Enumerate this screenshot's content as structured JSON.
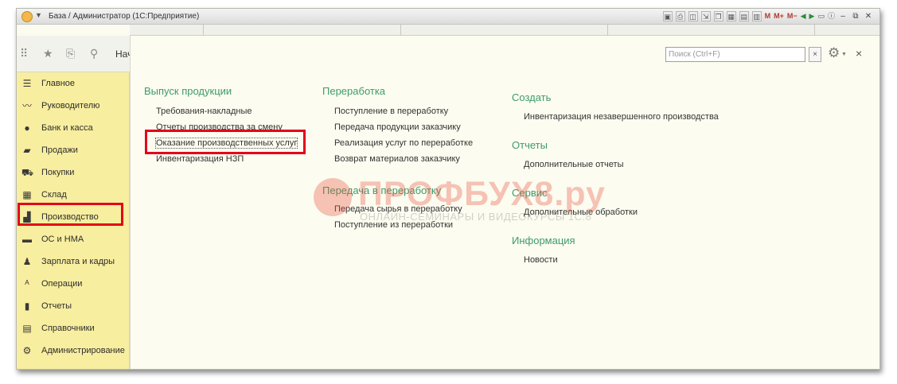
{
  "window": {
    "title": "База / Администратор  (1С:Предприятие)",
    "title_tools": [
      "M",
      "M+",
      "M−"
    ]
  },
  "toolbar": {
    "nav_text": "Нач"
  },
  "sidebar": {
    "items": [
      {
        "label": "Главное",
        "icon": "menu-icon"
      },
      {
        "label": "Руководителю",
        "icon": "chart-line-icon"
      },
      {
        "label": "Банк и касса",
        "icon": "coin-icon"
      },
      {
        "label": "Продажи",
        "icon": "bag-icon"
      },
      {
        "label": "Покупки",
        "icon": "cart-icon"
      },
      {
        "label": "Склад",
        "icon": "warehouse-icon"
      },
      {
        "label": "Производство",
        "icon": "factory-icon"
      },
      {
        "label": "ОС и НМА",
        "icon": "truck-icon"
      },
      {
        "label": "Зарплата и кадры",
        "icon": "person-icon"
      },
      {
        "label": "Операции",
        "icon": "operations-icon"
      },
      {
        "label": "Отчеты",
        "icon": "bar-chart-icon"
      },
      {
        "label": "Справочники",
        "icon": "book-icon"
      },
      {
        "label": "Администрирование",
        "icon": "gear-icon"
      }
    ],
    "selected": "Производство"
  },
  "panel": {
    "search_placeholder": "Поиск (Ctrl+F)",
    "search_clear": "×",
    "close": "×",
    "columns": [
      {
        "sections": [
          {
            "title": "Выпуск продукции",
            "links": [
              "Требования-накладные",
              "Отчеты производства за смену",
              "Оказание производственных услуг",
              "Инвентаризация НЗП"
            ]
          }
        ]
      },
      {
        "sections": [
          {
            "title": "Переработка",
            "links": [
              "Поступление в переработку",
              "Передача продукции заказчику",
              "Реализация услуг по переработке",
              "Возврат материалов заказчику"
            ]
          },
          {
            "title": "Передача в переработку",
            "links": [
              "Передача сырья в переработку",
              "Поступление из переработки"
            ]
          }
        ]
      },
      {
        "sections": [
          {
            "title": "Создать",
            "links": [
              "Инвентаризация незавершенного производства"
            ]
          },
          {
            "title": "Отчеты",
            "links": [
              "Дополнительные отчеты"
            ]
          },
          {
            "title": "Сервис",
            "links": [
              "Дополнительные обработки"
            ]
          },
          {
            "title": "Информация",
            "links": [
              "Новости"
            ]
          }
        ]
      }
    ],
    "focused_link": "Оказание производственных услуг"
  },
  "watermark": {
    "main": "ПРОФБУХ8.ру",
    "sub": "ОНЛАЙН-СЕМИНАРЫ И ВИДЕОКУРСЫ 1С:8"
  },
  "colors": {
    "accent_green": "#3e9b6a",
    "sidebar_bg": "#f8ee9f",
    "highlight_red": "#e4001b"
  }
}
